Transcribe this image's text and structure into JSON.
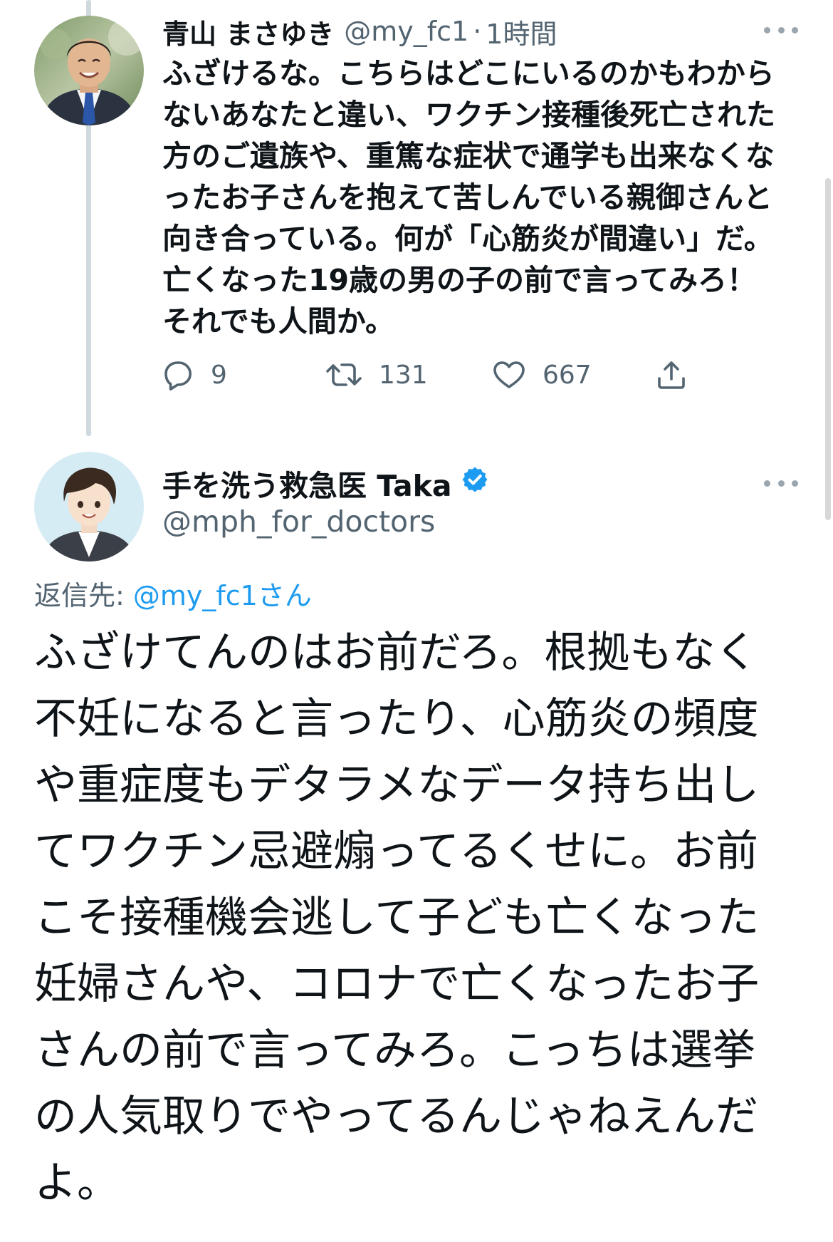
{
  "tweet1": {
    "display_name": "青山 まさゆき",
    "handle": "@my_fc1",
    "separator": "·",
    "time": "1時間",
    "avatar_icon": "user-photo-man-suit",
    "text": "ふざけるな。こちらはどこにいるのかもわから\nないあなたと違い、ワクチン接種後死亡された\n方のご遺族や、重篤な症状で通学も出来なくな\nったお子さんを抱えて苦しんでいる親御さんと\n向き合っている。何が「心筋炎が間違い」だ。\n亡くなった19歳の男の子の前で言ってみろ！\nそれでも人間か。",
    "replies": "9",
    "retweets": "131",
    "likes": "667"
  },
  "tweet2": {
    "display_name": "手を洗う救急医 Taka",
    "verified": true,
    "handle": "@mph_for_doctors",
    "avatar_icon": "illustrated-doctor-avatar",
    "reply_label": "返信先: ",
    "reply_mention": "@my_fc1さん",
    "text": "ふざけてんのはお前だろ。根拠もなく\n不妊になると言ったり、心筋炎の頻度\nや重症度もデタラメなデータ持ち出し\nてワクチン忌避煽ってるくせに。お前\nこそ接種機会逃して子ども亡くなった\n妊婦さんや、コロナで亡くなったお子\nさんの前で言ってみろ。こっちは選挙\nの人気取りでやってるんじゃねえんだ\nよ。"
  },
  "colors": {
    "accent": "#1d9bf0",
    "secondary_text": "#536471",
    "primary_text": "#0f1419",
    "thread_line": "#cfd9de"
  }
}
